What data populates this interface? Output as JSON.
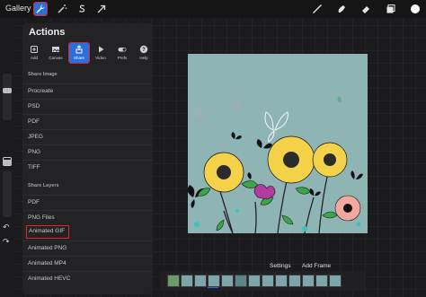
{
  "topbar": {
    "gallery_label": "Gallery",
    "left_icons": [
      "wrench-icon",
      "magic-wand-icon",
      "selection-s-icon",
      "transform-arrow-icon"
    ],
    "right_icons": [
      "brush-icon",
      "smudge-icon",
      "eraser-icon",
      "layers-icon",
      "color-swatch-icon"
    ],
    "active_tool": "wrench-icon",
    "highlight_color": "#e0242b",
    "accent_color": "#2a6fdc",
    "color_swatch": "#ffffff"
  },
  "actions": {
    "title": "Actions",
    "tabs": [
      {
        "label": "Add",
        "icon": "add-icon"
      },
      {
        "label": "Canvas",
        "icon": "canvas-icon"
      },
      {
        "label": "Share",
        "icon": "share-icon",
        "active": true
      },
      {
        "label": "Video",
        "icon": "video-icon"
      },
      {
        "label": "Prefs",
        "icon": "toggle-icon"
      },
      {
        "label": "Help",
        "icon": "help-icon"
      }
    ],
    "share_image_header": "Share Image",
    "share_image_items": [
      "Procreate",
      "PSD",
      "PDF",
      "JPEG",
      "PNG",
      "TIFF"
    ],
    "share_layers_header": "Share Layers",
    "share_layers_items": [
      "PDF",
      "PNG Files",
      "Animated GIF",
      "Animated PNG",
      "Animated MP4",
      "Animated HEVC"
    ],
    "highlighted_item": "Animated GIF"
  },
  "animation": {
    "settings_label": "Settings",
    "add_frame_label": "Add Frame",
    "frame_count": 13,
    "selected_frame": 3
  },
  "canvas": {
    "background_color": "#8fb4b4"
  }
}
